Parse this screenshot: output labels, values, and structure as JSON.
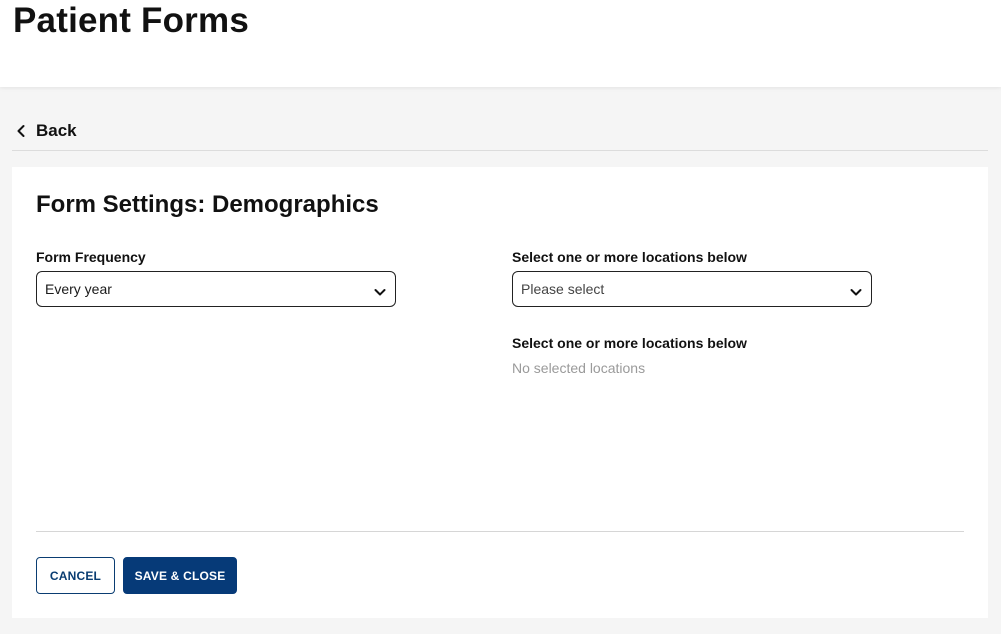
{
  "header": {
    "title": "Patient Forms"
  },
  "nav": {
    "back_label": "Back"
  },
  "form": {
    "title": "Form Settings: Demographics",
    "frequency": {
      "label": "Form Frequency",
      "value": "Every year"
    },
    "locations_select": {
      "label": "Select one or more locations below",
      "placeholder": "Please select"
    },
    "selected_locations": {
      "label": "Select one or more locations below",
      "empty_text": "No selected locations"
    }
  },
  "actions": {
    "cancel_label": "CANCEL",
    "save_label": "SAVE & CLOSE"
  },
  "colors": {
    "primary": "#063a78",
    "background": "#f5f5f5",
    "surface": "#ffffff"
  },
  "icons": {
    "back": "chevron-left-icon",
    "dropdown": "chevron-down-icon"
  }
}
